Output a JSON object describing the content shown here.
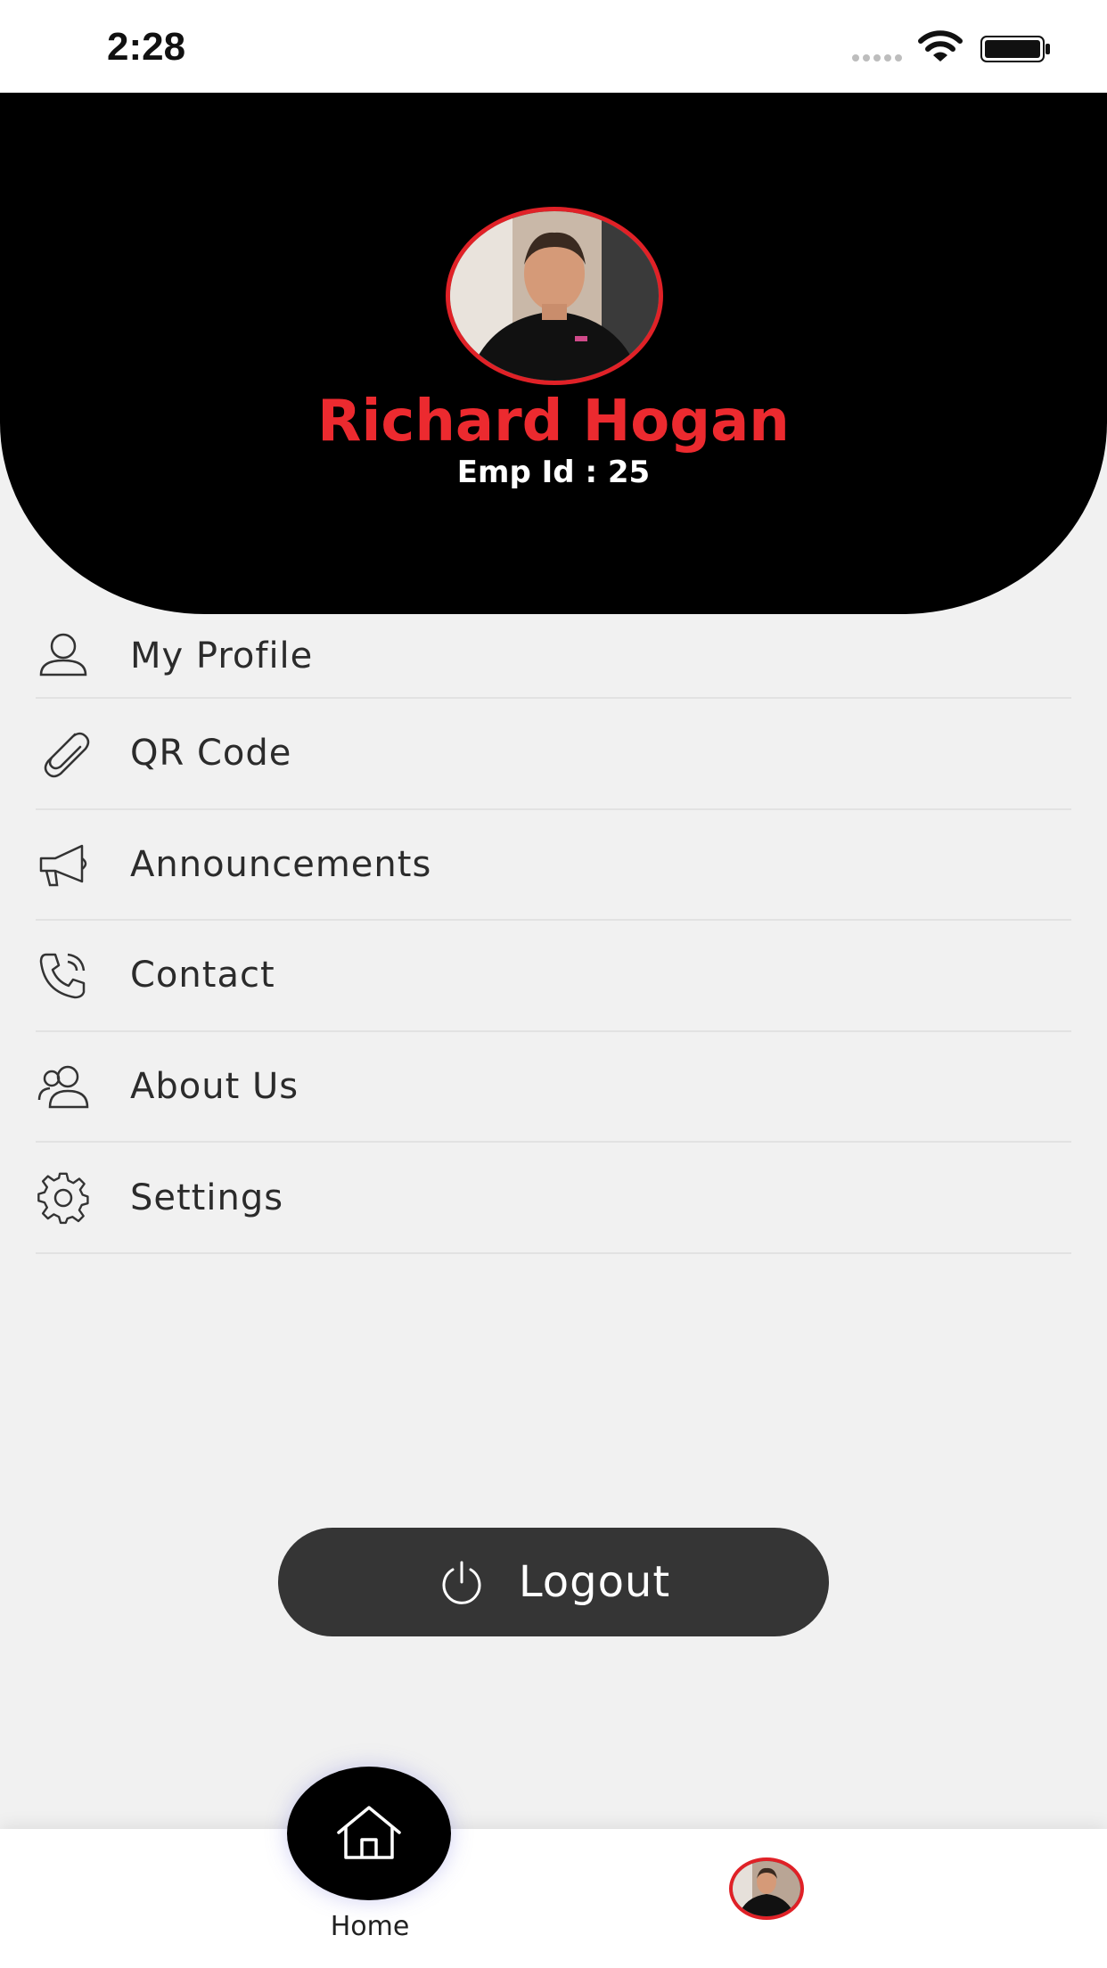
{
  "status_bar": {
    "time": "2:28"
  },
  "profile": {
    "name": "Richard Hogan",
    "emp_id": "Emp Id : 25"
  },
  "menu": {
    "items": [
      {
        "label": "My Profile",
        "icon": "person-icon"
      },
      {
        "label": "QR Code",
        "icon": "paperclip-icon"
      },
      {
        "label": "Announcements",
        "icon": "megaphone-icon"
      },
      {
        "label": "Contact",
        "icon": "phone-icon"
      },
      {
        "label": "About Us",
        "icon": "people-icon"
      },
      {
        "label": "Settings",
        "icon": "gear-icon"
      }
    ]
  },
  "logout": {
    "label": "Logout"
  },
  "bottom_nav": {
    "home_label": "Home"
  },
  "colors": {
    "accent_red": "#e02127",
    "header_black": "#000000",
    "button_dark": "#353535",
    "background": "#f1f1f1"
  }
}
